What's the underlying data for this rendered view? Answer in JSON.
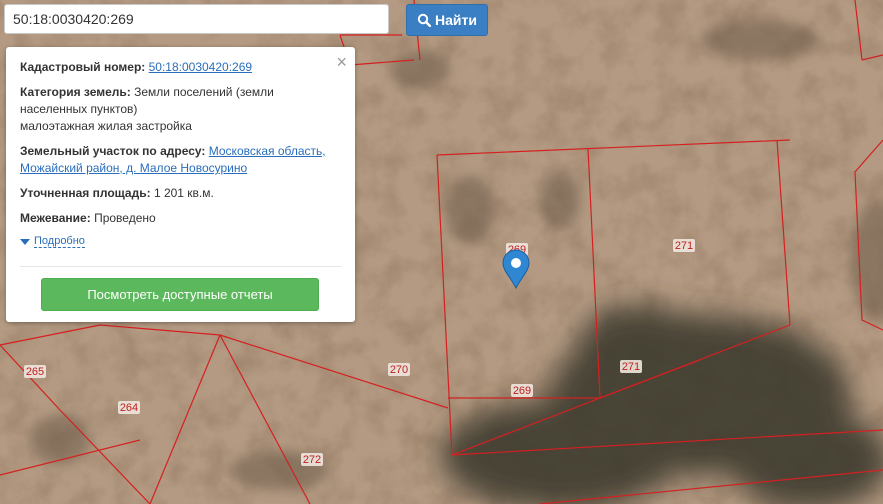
{
  "search": {
    "value": "50:18:0030420:269",
    "button_label": "Найти"
  },
  "info": {
    "cadastral_label": "Кадастровый номер:",
    "cadastral_value": "50:18:0030420:269",
    "category_label": "Категория земель:",
    "category_value_1": "Земли поселений (земли",
    "category_value_2": "населенных пунктов)",
    "category_value_3": "малоэтажная жилая застройка",
    "address_label": "Земельный участок по адресу:",
    "address_value_1": "Московская область,",
    "address_value_2": "Можайский район, д. Малое Новосурино",
    "area_label": "Уточненная площадь:",
    "area_value": "1 201 кв.м.",
    "survey_label": "Межевание:",
    "survey_value": "Проведено",
    "more_link": "Подробно",
    "report_button": "Посмотреть доступные отчеты",
    "close": "×"
  },
  "parcels": {
    "p265": "265",
    "p264": "264",
    "p270": "270",
    "p269_top": "269",
    "p269_bottom": "269",
    "p271_top": "271",
    "p271_bottom": "271",
    "p272": "272"
  },
  "colors": {
    "boundary": "#d42020",
    "marker": "#2f86d1",
    "report_button": "#5cb85c",
    "search_button": "#3a7fc3"
  }
}
